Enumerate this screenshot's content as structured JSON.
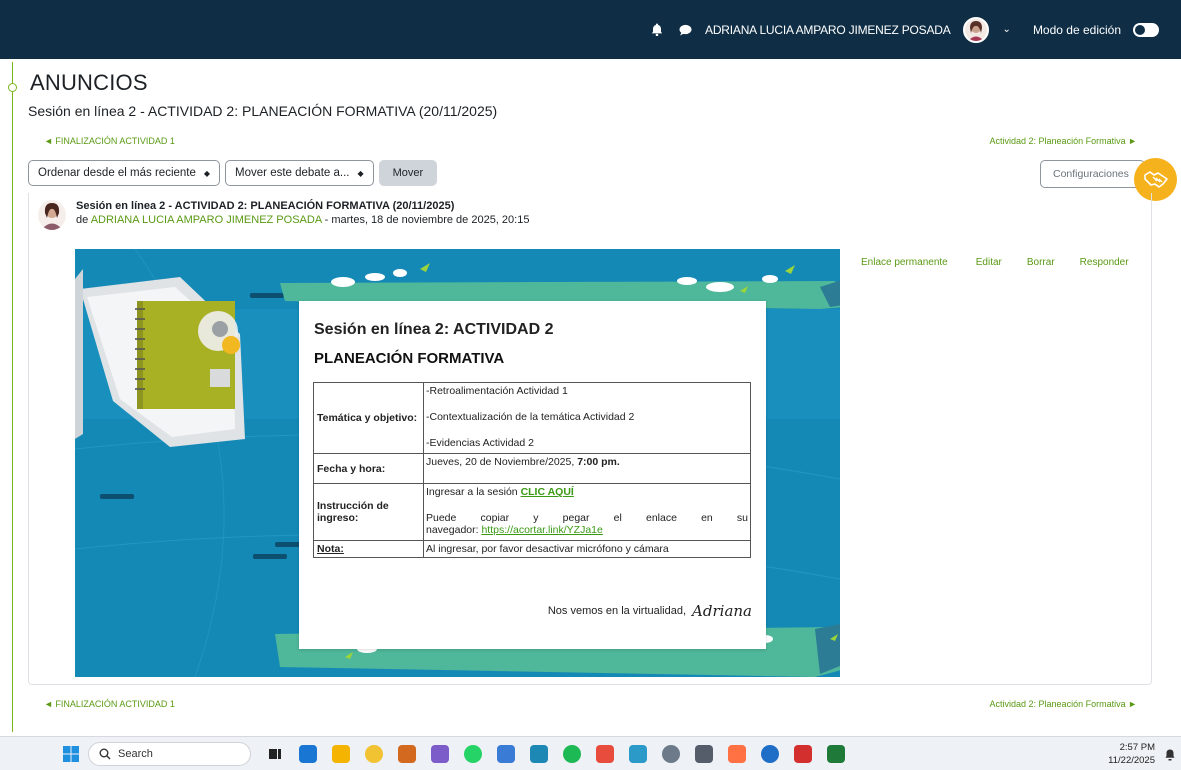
{
  "topnav": {
    "user_name": "ADRIANA LUCIA AMPARO JIMENEZ POSADA",
    "edit_mode_label": "Modo de edición",
    "bell_icon": "bell-icon",
    "message_icon": "chat-bubble-icon",
    "bg_color": "#0f2e45"
  },
  "page": {
    "title": "ANUNCIOS",
    "discussion_title": "Sesión en línea 2 - ACTIVIDAD 2: PLANEACIÓN FORMATIVA (20/11/2025)",
    "prev_link": "◄ FINALIZACIÓN ACTIVIDAD 1",
    "next_link": "Actividad 2: Planeación Formativa ►",
    "accent_color": "#5a9a14"
  },
  "controls": {
    "sort_label": "Ordenar desde el más reciente",
    "move_label": "Mover este debate a...",
    "move_button": "Mover",
    "settings_label": "Configuraciones"
  },
  "post": {
    "subject": "Sesión en línea 2 - ACTIVIDAD 2: PLANEACIÓN FORMATIVA (20/11/2025)",
    "by": "de ",
    "author": "ADRIANA LUCIA AMPARO JIMENEZ POSADA",
    "date": " - martes, 18 de noviembre de 2025, 20:15",
    "actions": [
      "Enlace permanente",
      "Editar",
      "Borrar",
      "Responder"
    ]
  },
  "banner": {
    "heading": "Sesión en línea 2: ACTIVIDAD 2",
    "subheading": "PLANEACIÓN FORMATIVA",
    "rows": {
      "tema_label": "Temática y objetivo:",
      "tema_items": [
        "-Retroalimentación Actividad 1",
        "-Contextualización de la temática Actividad 2",
        "-Evidencias Actividad 2"
      ],
      "fecha_label": "Fecha y hora:",
      "fecha_text": "Jueves, 20 de Noviembre/2025, ",
      "fecha_time": "7:00 pm.",
      "instr_label": "Instrucción de ingreso:",
      "instr_text": "Ingresar a la sesión ",
      "instr_link": "CLIC AQUÍ",
      "instr_words": [
        "Puede",
        "copiar",
        "y",
        "pegar",
        "el",
        "enlace",
        "en",
        "su"
      ],
      "instr_nav": "navegador: ",
      "instr_url": "https://acortar.link/YZJa1e",
      "nota_label": "Nota:",
      "nota_text": "Al ingresar, por favor desactivar micrófono y cámara"
    },
    "signoff": "Nos vemos en la virtualidad,",
    "signature": "Adriana"
  },
  "taskbar": {
    "search_placeholder": "Search",
    "time": "2:57 PM",
    "date": "11/22/2025",
    "apps": [
      "task-view-icon",
      "app-blue-icon",
      "chrome-icon",
      "file-explorer-icon",
      "app-orange-icon",
      "copilot-icon",
      "whatsapp-icon",
      "app-grid-icon",
      "edge-icon",
      "spotify-icon",
      "chrome-profile-icon",
      "edge-dev-icon",
      "settings-icon",
      "calculator-icon",
      "app-colorful-icon",
      "outlook-icon",
      "acrobat-icon",
      "excel-icon"
    ],
    "app_colors": [
      "#222222",
      "#1976d2",
      "#f4b400",
      "#f1c232",
      "#d2691e",
      "#7b5cc9",
      "#25d366",
      "#3a7bd5",
      "#1e88b5",
      "#1db954",
      "#e84c3d",
      "#2c9ac9",
      "#6c7a89",
      "#555d6b",
      "#ff7043",
      "#1e6ec8",
      "#d32f2f",
      "#1f7a3a"
    ]
  }
}
